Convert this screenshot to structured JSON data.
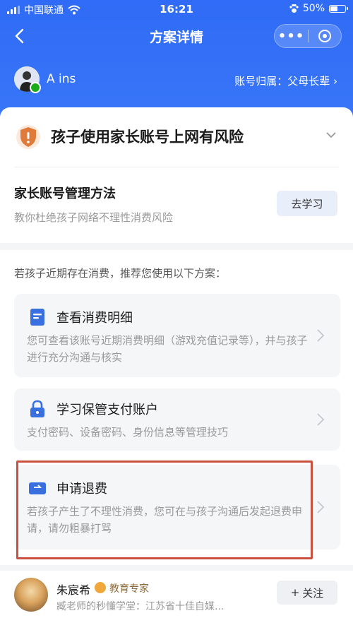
{
  "status_bar": {
    "carrier": "中国联通",
    "time": "16:21",
    "battery": "50%"
  },
  "nav": {
    "title": "方案详情",
    "more_icon": "more-dots-icon",
    "close_icon": "mini-program-close-icon"
  },
  "user": {
    "name": "A ins",
    "owner_label": "账号归属：父母长辈"
  },
  "risk": {
    "title": "孩子使用家长账号上网有风险"
  },
  "management": {
    "title": "家长账号管理方法",
    "desc": "教你杜绝孩子网络不理性消费风险",
    "button": "去学习"
  },
  "plans": {
    "intro": "若孩子近期存在消费，推荐您使用以下方案：",
    "items": [
      {
        "title": "查看消费明细",
        "desc": "您可查看该账号近期消费明细（游戏充值记录等），并与孩子进行充分沟通与核实",
        "icon": "document-icon"
      },
      {
        "title": "学习保管支付账户",
        "desc": "支付密码、设备密码、身份信息等管理技巧",
        "icon": "lock-icon"
      },
      {
        "title": "申请退费",
        "desc": "若孩子产生了不理性消费，您可在与孩子沟通后发起退费申请，请勿粗暴打骂",
        "icon": "refund-card-icon"
      }
    ]
  },
  "author": {
    "name": "朱宸希",
    "tag": "教育专家",
    "desc": "臧老师的秒懂学堂：江苏省十佳自媒...",
    "follow": "关注"
  },
  "colors": {
    "primary": "#2f6bf6",
    "highlight_border": "#c9513f",
    "risk_orange": "#e07a3a"
  }
}
